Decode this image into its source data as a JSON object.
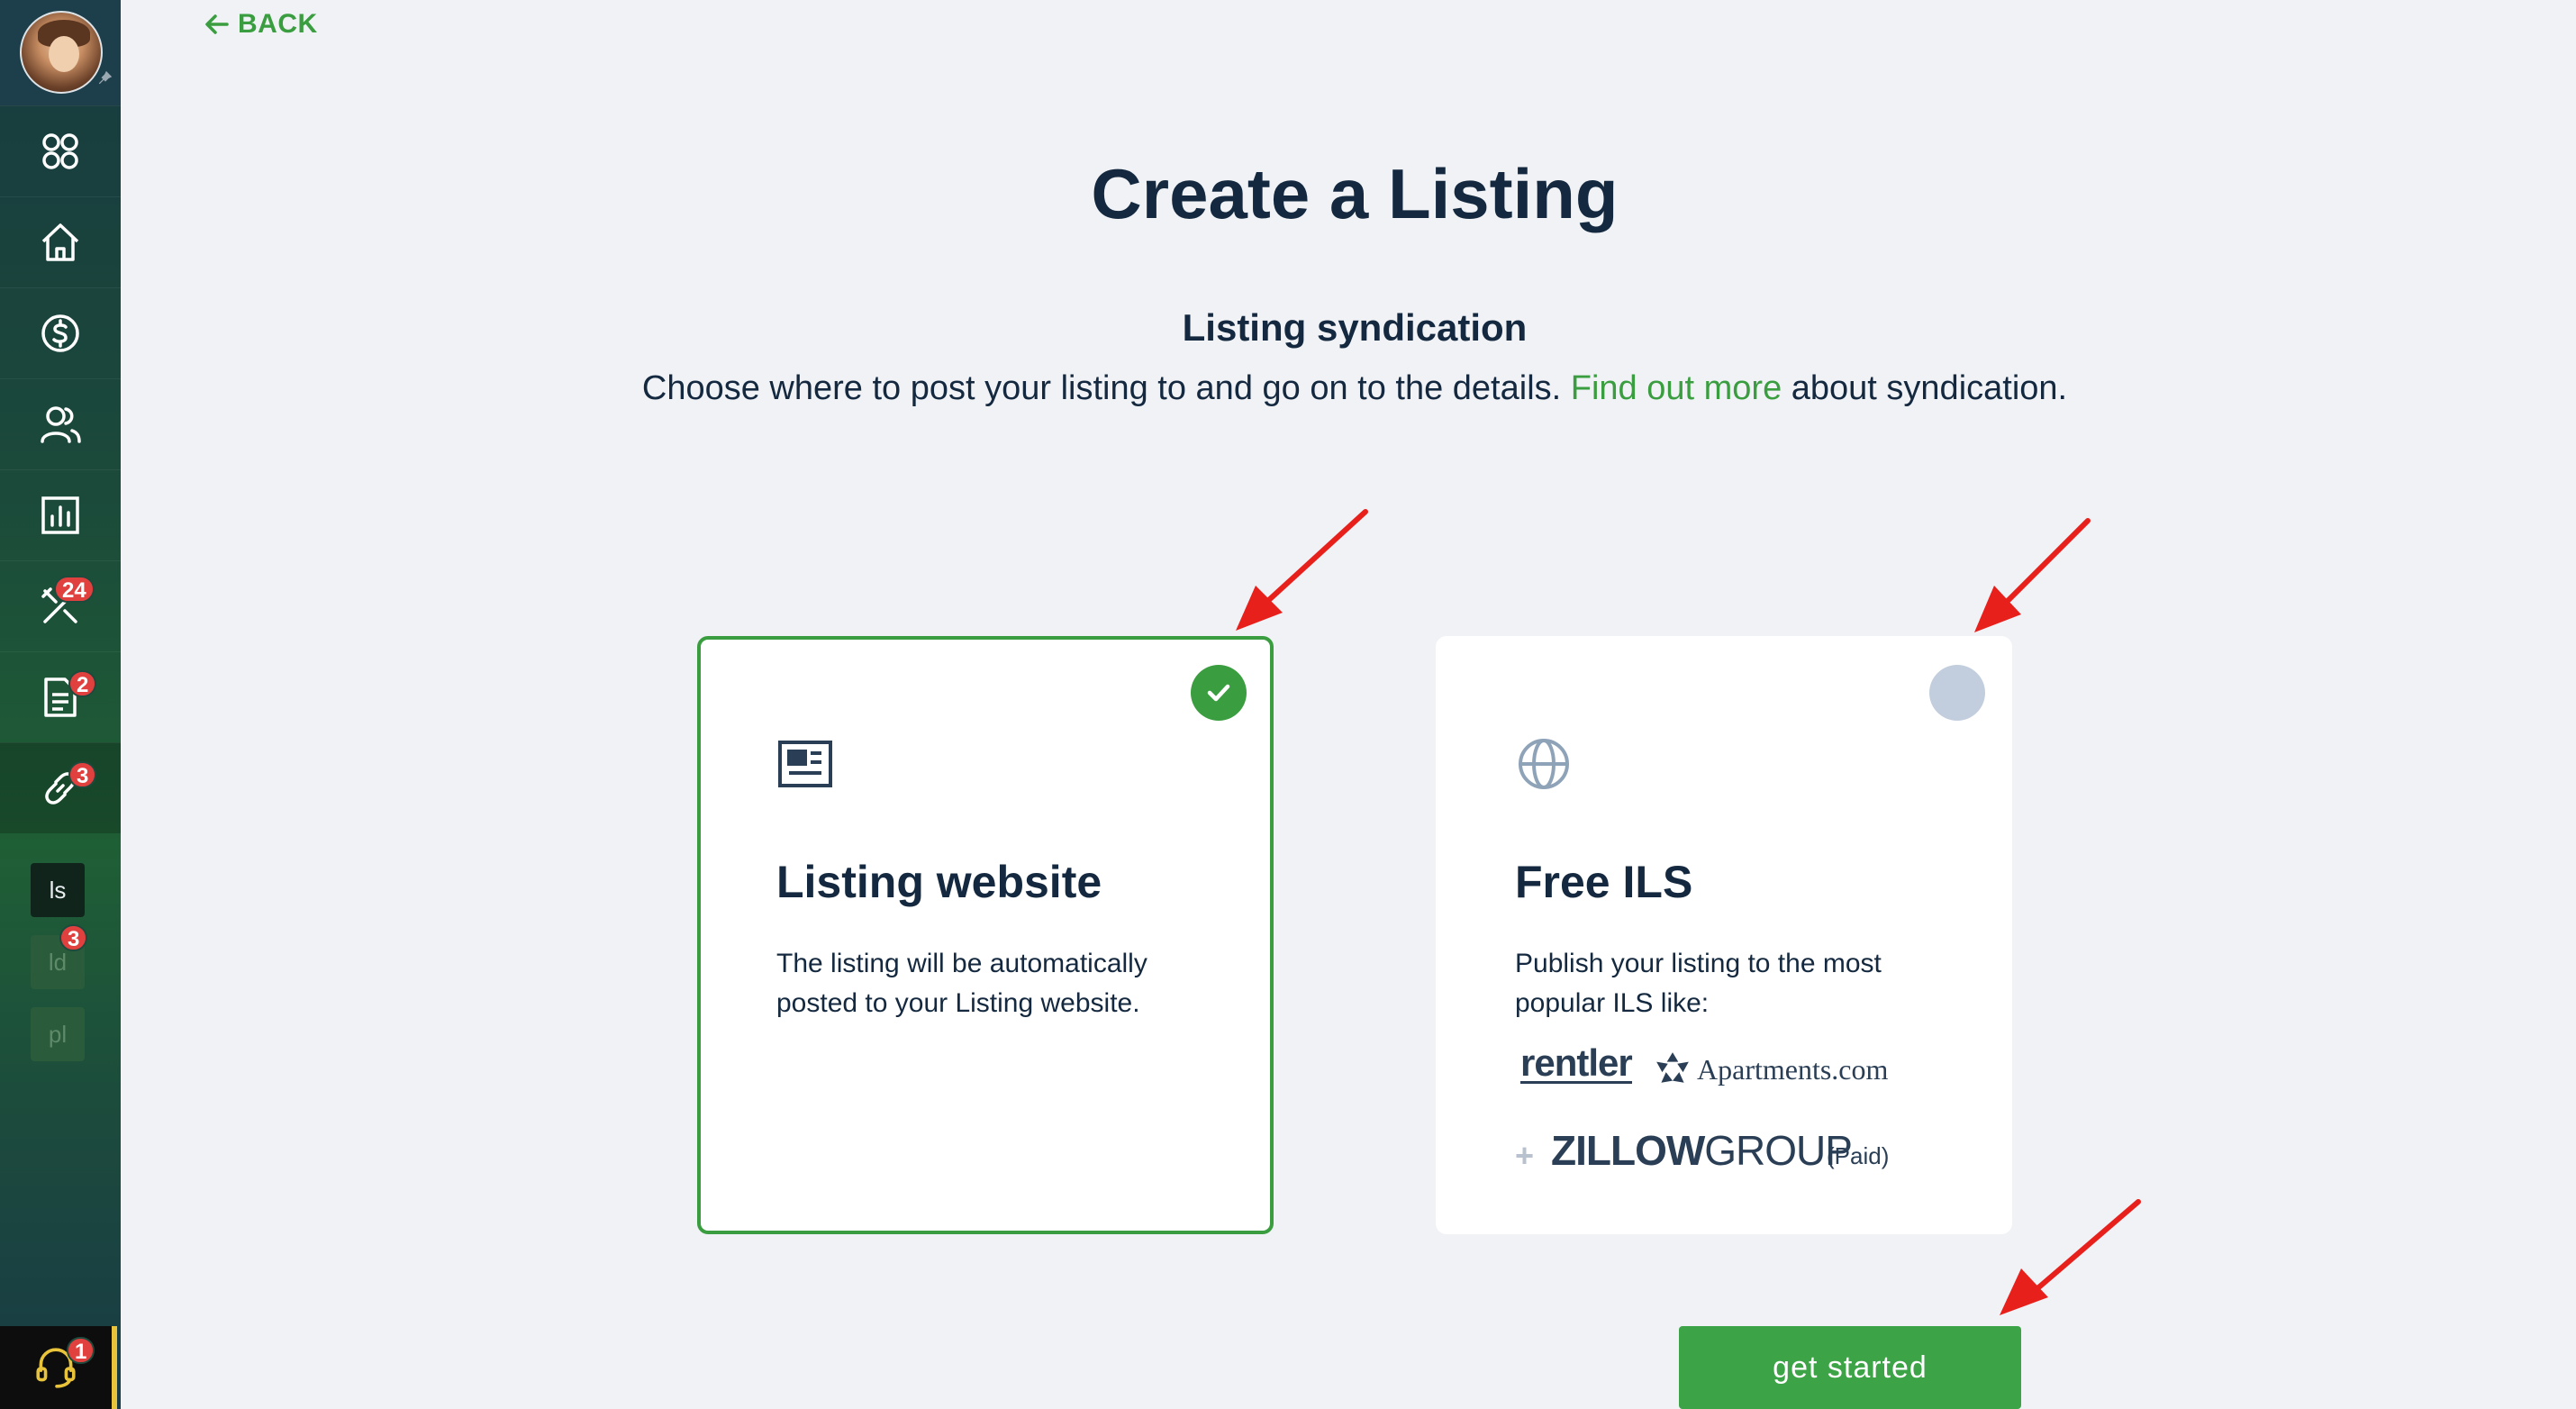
{
  "sidebar": {
    "nav_items": [
      {
        "name": "apps",
        "icon": "apps-grid-icon"
      },
      {
        "name": "home",
        "icon": "home-icon"
      },
      {
        "name": "payments",
        "icon": "dollar-circle-icon"
      },
      {
        "name": "people",
        "icon": "users-icon"
      },
      {
        "name": "reports",
        "icon": "bar-chart-icon"
      },
      {
        "name": "maintenance",
        "icon": "tools-icon",
        "badge": "24"
      },
      {
        "name": "documents",
        "icon": "document-icon",
        "badge": "2"
      },
      {
        "name": "listings",
        "icon": "link-icon",
        "badge": "3"
      }
    ],
    "sub_items": [
      {
        "label": "ls"
      },
      {
        "label": "ld",
        "badge": "3"
      },
      {
        "label": "pl"
      }
    ],
    "support_badge": "1"
  },
  "header": {
    "back_label": "BACK"
  },
  "page": {
    "title": "Create a Listing",
    "section_title": "Listing syndication",
    "description_before": "Choose where to post your listing to and go on to the details. ",
    "description_link": "Find out more",
    "description_after": " about syndication."
  },
  "cards": [
    {
      "title": "Listing website",
      "description": "The listing will be automatically posted to your Listing website.",
      "selected": true,
      "icon": "newspaper-icon"
    },
    {
      "title": "Free ILS",
      "description": "Publish your listing to the most popular ILS like:",
      "selected": false,
      "icon": "globe-icon",
      "logos": {
        "rentler": "rentler",
        "apartments": "Apartments.com",
        "zillow_bold": "ZILLOW",
        "zillow_light": "GROUP",
        "paid": "(Paid)"
      }
    }
  ],
  "actions": {
    "get_started_label": "get started"
  },
  "colors": {
    "accent": "#3a9d3f",
    "title": "#14293f",
    "badge": "#e0403e",
    "annotation": "#e8201c"
  }
}
